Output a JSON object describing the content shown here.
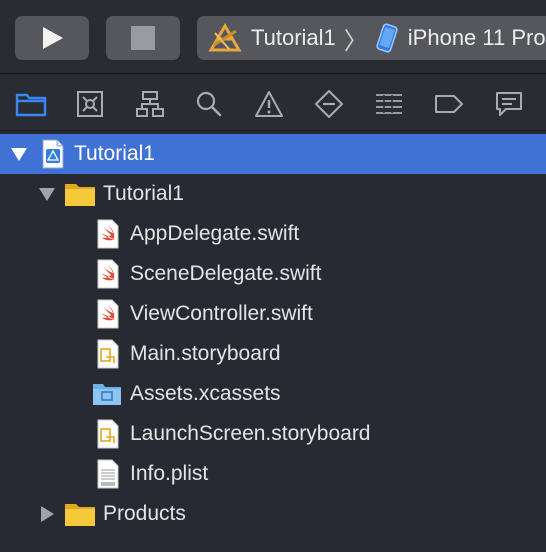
{
  "toolbar": {
    "scheme_name": "Tutorial1",
    "breadcrumb_separator": "〉",
    "destination": "iPhone 11 Pro"
  },
  "navigator_tabs": [
    {
      "name": "project-navigator",
      "icon": "folder-icon",
      "selected": true
    },
    {
      "name": "source-control-navigator",
      "icon": "source-control-icon",
      "selected": false
    },
    {
      "name": "symbol-navigator",
      "icon": "hierarchy-icon",
      "selected": false
    },
    {
      "name": "find-navigator",
      "icon": "magnifier-icon",
      "selected": false
    },
    {
      "name": "issue-navigator",
      "icon": "warning-icon",
      "selected": false
    },
    {
      "name": "test-navigator",
      "icon": "diamond-icon",
      "selected": false
    },
    {
      "name": "debug-navigator",
      "icon": "list-icon",
      "selected": false
    },
    {
      "name": "breakpoint-navigator",
      "icon": "tag-icon",
      "selected": false
    },
    {
      "name": "report-navigator",
      "icon": "speech-bubble-icon",
      "selected": false
    }
  ],
  "tree": {
    "project": {
      "label": "Tutorial1",
      "expanded": true,
      "selected": true
    },
    "group": {
      "label": "Tutorial1",
      "expanded": true
    },
    "files": [
      {
        "label": "AppDelegate.swift",
        "type": "swift-file-icon"
      },
      {
        "label": "SceneDelegate.swift",
        "type": "swift-file-icon"
      },
      {
        "label": "ViewController.swift",
        "type": "swift-file-icon"
      },
      {
        "label": "Main.storyboard",
        "type": "storyboard-file-icon"
      },
      {
        "label": "Assets.xcassets",
        "type": "asset-catalog-icon"
      },
      {
        "label": "LaunchScreen.storyboard",
        "type": "storyboard-file-icon"
      },
      {
        "label": "Info.plist",
        "type": "plist-file-icon"
      }
    ],
    "products": {
      "label": "Products",
      "expanded": false
    }
  },
  "colors": {
    "accent_selection": "#3f72d4",
    "folder_yellow": "#f2c230",
    "swift_red": "#e8492f",
    "nav_selected_blue": "#3b86f7"
  }
}
